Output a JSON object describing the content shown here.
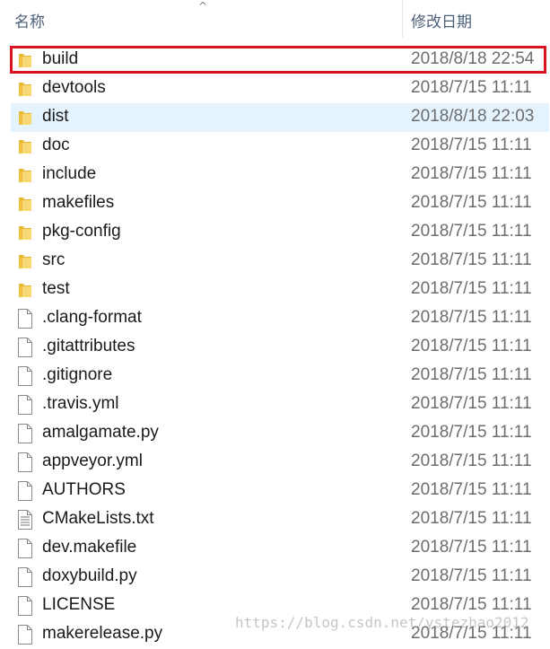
{
  "header": {
    "name_label": "名称",
    "date_label": "修改日期",
    "sort_indicator": "^"
  },
  "files": [
    {
      "name": "build",
      "date": "2018/8/18 22:54",
      "type": "folder",
      "state": "outlined"
    },
    {
      "name": "devtools",
      "date": "2018/7/15 11:11",
      "type": "folder"
    },
    {
      "name": "dist",
      "date": "2018/8/18 22:03",
      "type": "folder",
      "state": "hover"
    },
    {
      "name": "doc",
      "date": "2018/7/15 11:11",
      "type": "folder"
    },
    {
      "name": "include",
      "date": "2018/7/15 11:11",
      "type": "folder"
    },
    {
      "name": "makefiles",
      "date": "2018/7/15 11:11",
      "type": "folder"
    },
    {
      "name": "pkg-config",
      "date": "2018/7/15 11:11",
      "type": "folder"
    },
    {
      "name": "src",
      "date": "2018/7/15 11:11",
      "type": "folder"
    },
    {
      "name": "test",
      "date": "2018/7/15 11:11",
      "type": "folder"
    },
    {
      "name": ".clang-format",
      "date": "2018/7/15 11:11",
      "type": "file"
    },
    {
      "name": ".gitattributes",
      "date": "2018/7/15 11:11",
      "type": "file"
    },
    {
      "name": ".gitignore",
      "date": "2018/7/15 11:11",
      "type": "file"
    },
    {
      "name": ".travis.yml",
      "date": "2018/7/15 11:11",
      "type": "file"
    },
    {
      "name": "amalgamate.py",
      "date": "2018/7/15 11:11",
      "type": "file"
    },
    {
      "name": "appveyor.yml",
      "date": "2018/7/15 11:11",
      "type": "file"
    },
    {
      "name": "AUTHORS",
      "date": "2018/7/15 11:11",
      "type": "file"
    },
    {
      "name": "CMakeLists.txt",
      "date": "2018/7/15 11:11",
      "type": "textfile"
    },
    {
      "name": "dev.makefile",
      "date": "2018/7/15 11:11",
      "type": "file"
    },
    {
      "name": "doxybuild.py",
      "date": "2018/7/15 11:11",
      "type": "file"
    },
    {
      "name": "LICENSE",
      "date": "2018/7/15 11:11",
      "type": "file"
    },
    {
      "name": "makerelease.py",
      "date": "2018/7/15 11:11",
      "type": "file"
    }
  ],
  "watermark": "https://blog.csdn.net/ystezhao2012",
  "colors": {
    "folder": "#f4c542",
    "outline": "#d9121f",
    "hover": "#e5f3ff"
  }
}
